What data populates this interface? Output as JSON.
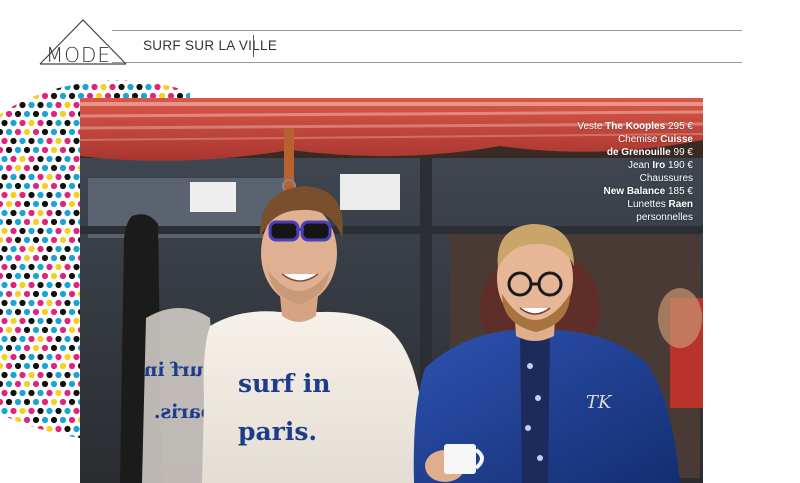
{
  "header": {
    "logo_text": "MODE",
    "section_title": "SURF SUR LA VILLE"
  },
  "photo": {
    "shirt_line1": "surf in",
    "shirt_line2": "paris.",
    "board_line1": "surf in",
    "board_line2": "paris."
  },
  "credits": {
    "l1_pre": "Veste ",
    "l1_brand": "The Kooples",
    "l1_price": " 295 €",
    "l2_pre": "Chemise ",
    "l2_brand": "Cuisse",
    "l3_brand": "de Grenouille",
    "l3_price": " 99 €",
    "l4_pre": "Jean ",
    "l4_brand": "Iro",
    "l4_price": " 190 €",
    "l5_pre": "Chaussures",
    "l6_brand": "New Balance",
    "l6_price": " 185 €",
    "l7_pre": "Lunettes ",
    "l7_brand": "Raen",
    "l8_pre": "personnelles"
  },
  "colors": {
    "awning_red": "#c8453a",
    "awning_pink": "#e7a7a0",
    "shirt_navy": "#1d3d8c",
    "jacket_blue": "#1f3f93",
    "sweater_cream": "#f2ece4"
  }
}
